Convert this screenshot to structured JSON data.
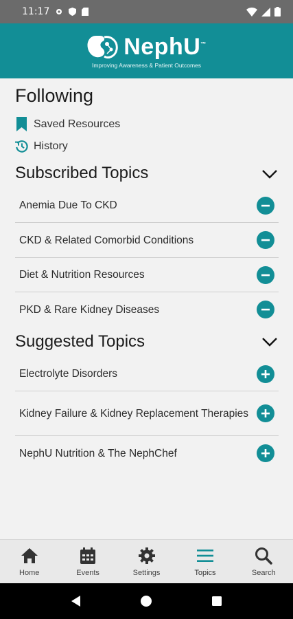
{
  "status_bar": {
    "time": "11:17"
  },
  "header": {
    "brand": "NephU",
    "trademark": "™",
    "tagline": "Improving Awareness & Patient Outcomes"
  },
  "page": {
    "title": "Following",
    "links": [
      {
        "label": "Saved Resources",
        "icon": "bookmark-icon"
      },
      {
        "label": "History",
        "icon": "history-icon"
      }
    ]
  },
  "subscribed": {
    "title": "Subscribed Topics",
    "topics": [
      "Anemia Due To CKD",
      "CKD & Related Comorbid Conditions",
      "Diet & Nutrition Resources",
      "PKD & Rare Kidney Diseases"
    ]
  },
  "suggested": {
    "title": "Suggested Topics",
    "topics": [
      "Electrolyte Disorders",
      "Kidney Failure & Kidney Replacement Therapies",
      "NephU Nutrition & The NephChef"
    ]
  },
  "bottom_nav": [
    {
      "label": "Home",
      "icon": "home-icon"
    },
    {
      "label": "Events",
      "icon": "calendar-icon"
    },
    {
      "label": "Settings",
      "icon": "gear-icon"
    },
    {
      "label": "Topics",
      "icon": "menu-icon",
      "active": true
    },
    {
      "label": "Search",
      "icon": "search-icon"
    }
  ],
  "colors": {
    "brand": "#128e96",
    "active_nav": "#128e96"
  }
}
